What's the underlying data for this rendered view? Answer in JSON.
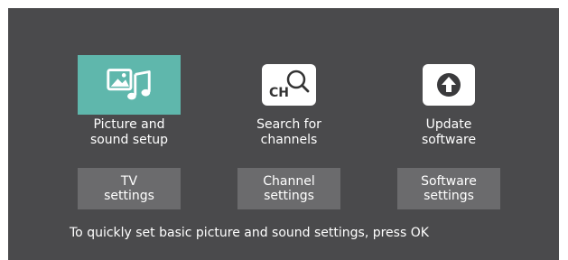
{
  "options": [
    {
      "label": "Picture and\nsound setup",
      "icon": "picture-sound-icon",
      "selected": true
    },
    {
      "label": "Search for\nchannels",
      "icon": "channel-search-icon",
      "selected": false,
      "icon_text": "CH"
    },
    {
      "label": "Update\nsoftware",
      "icon": "upload-icon",
      "selected": false
    }
  ],
  "buttons": [
    {
      "label": "TV\nsettings"
    },
    {
      "label": "Channel\nsettings"
    },
    {
      "label": "Software\nsettings"
    }
  ],
  "hint": "To quickly set basic picture and sound settings, press OK",
  "colors": {
    "background": "#4a4a4c",
    "selected": "#5fb7ac",
    "button": "#6b6b6d",
    "text": "#ffffff"
  }
}
